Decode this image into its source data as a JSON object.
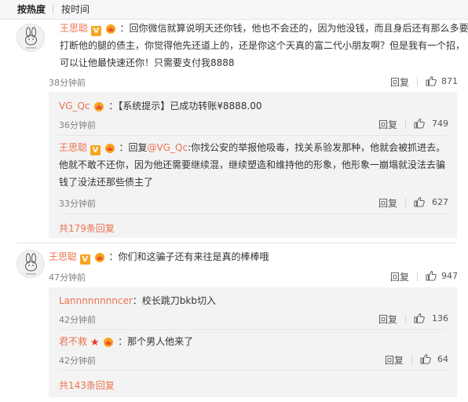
{
  "tabs": [
    "按热度",
    "按时间"
  ],
  "comments": [
    {
      "author": "王思聪",
      "text_lines": [
        "：回你微信就算说明天还你钱，他也不会还的，因为他没钱，而且身后还有那么多要",
        "打断他的腿的债主，你觉得他先还道上的，还是你这个天真的富二代小朋友啊？但是我有一个招，",
        "可以让他最快速还你！只需要支付我8888"
      ],
      "time": "38分钟前",
      "reply_label": "回复",
      "likes": "871",
      "replies": [
        {
          "author": "VG_Qc",
          "text_lines": [
            "：【系统提示】已成功转账¥8888.00"
          ],
          "time": "36分钟前",
          "reply_label": "回复",
          "likes": "749"
        },
        {
          "author": "王思聪",
          "reply_prefix": "：回复",
          "mention": "@VG_Qc",
          "text_lines": [
            ":你找公安的举报他吸毒，找关系验发那种，他就会被抓进去。",
            "他就不敢不还你，因为他还需要继续混，继续塑造和维持他的形象，他形象一崩塌就没法去骗",
            "钱了没法还那些债主了"
          ],
          "time": "33分钟前",
          "reply_label": "回复",
          "likes": "627"
        }
      ],
      "more_replies": "共179条回复"
    },
    {
      "author": "王思聪",
      "text_lines": [
        "：你们和这骗子还有来往是真的棒棒哦"
      ],
      "time": "47分钟前",
      "reply_label": "回复",
      "likes": "947",
      "replies": [
        {
          "author": "Lannnnnnnncer",
          "text_lines": [
            "：校长跳刀bkb切入"
          ],
          "time": "42分钟前",
          "reply_label": "回复",
          "likes": "136"
        },
        {
          "author": "君不救",
          "text_lines": [
            "：那个男人他来了"
          ],
          "time": "42分钟前",
          "reply_label": "回复",
          "likes": "64"
        }
      ],
      "more_replies": "共143条回复"
    }
  ],
  "icons": {
    "verified": "V",
    "vip": "vip-crown-icon",
    "star": "★",
    "like": "thumbs-up-icon",
    "avatar": "rabbit-avatar-icon"
  },
  "colors": {
    "accent": "#eb7350",
    "vip": "#f7a51f",
    "reply_bg": "#f3f3f3",
    "star": "#e23b2e"
  }
}
